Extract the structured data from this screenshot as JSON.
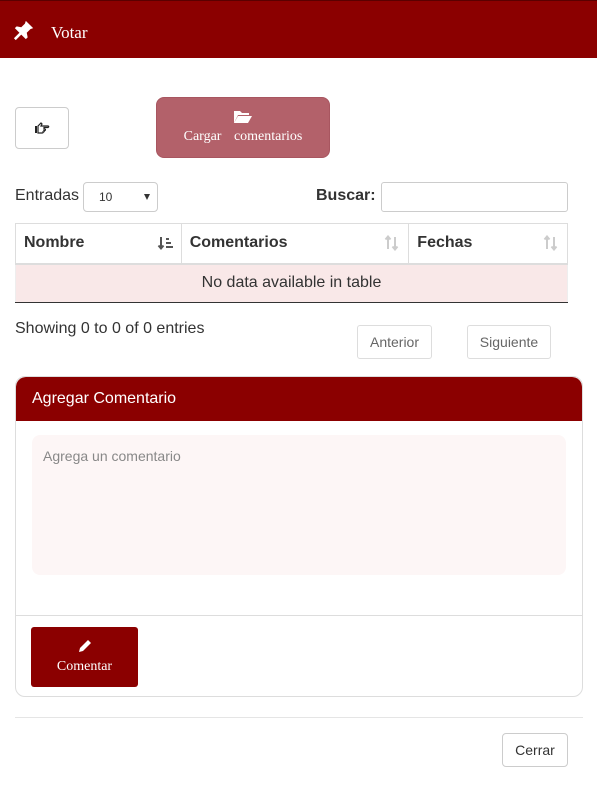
{
  "header": {
    "title": "Votar",
    "icon": "pin-icon"
  },
  "toolbar": {
    "pointer_icon": "hand-pointer-icon",
    "load_icon": "folder-open-icon",
    "load_label": "Cargar comentarios"
  },
  "table_controls": {
    "entries_label": "Entradas",
    "entries_value": "10",
    "search_label": "Buscar:",
    "search_value": ""
  },
  "table": {
    "columns": [
      "Nombre",
      "Comentarios",
      "Fechas"
    ],
    "empty_message": "No data available in table"
  },
  "pagination": {
    "info": "Showing 0 to 0 of 0 entries",
    "prev_label": "Anterior",
    "next_label": "Siguiente"
  },
  "comment_panel": {
    "title": "Agregar Comentario",
    "placeholder": "Agrega un comentario",
    "submit_label": "Comentar",
    "submit_icon": "pencil-icon"
  },
  "footer": {
    "close_label": "Cerrar"
  },
  "colors": {
    "primary": "#8b0000",
    "load_button": "#b3616a",
    "empty_row": "#f9e8e8"
  }
}
